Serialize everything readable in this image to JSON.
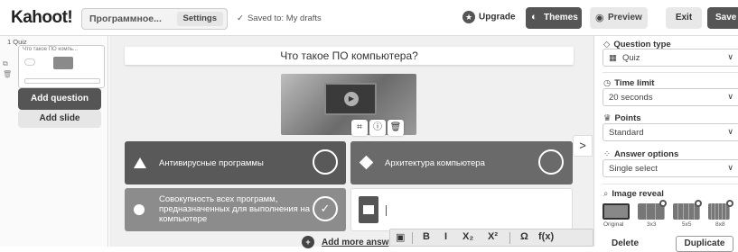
{
  "header": {
    "logo": "Kahoot!",
    "quiz_title": "Программное...",
    "settings_label": "Settings",
    "saved_text": "Saved to: My drafts",
    "upgrade_label": "Upgrade",
    "themes_label": "Themes",
    "preview_label": "Preview",
    "exit_label": "Exit",
    "save_label": "Save"
  },
  "sidebar": {
    "slide_label": "1 Quiz",
    "thumb_title": "Что такое ПО компь...",
    "add_question": "Add question",
    "add_slide": "Add slide"
  },
  "editor": {
    "question": "Что такое ПО компьютера?",
    "answers": [
      {
        "text": "Антивирусные программы",
        "shape": "triangle",
        "correct": false
      },
      {
        "text": "Архитектура компьютера",
        "shape": "diamond",
        "correct": false
      },
      {
        "text": "Совокупность всех программ, предназначенных для выполнения на компьютере",
        "shape": "circle",
        "correct": true
      },
      {
        "text": "",
        "shape": "square",
        "correct": false
      }
    ],
    "add_more": "Add more answ",
    "format_tools": [
      "B",
      "I",
      "X₂",
      "X²",
      "Ω",
      "f(x)"
    ]
  },
  "panel": {
    "question_type_label": "Question type",
    "question_type_value": "Quiz",
    "time_limit_label": "Time limit",
    "time_limit_value": "20 seconds",
    "points_label": "Points",
    "points_value": "Standard",
    "answer_options_label": "Answer options",
    "answer_options_value": "Single select",
    "image_reveal_label": "Image reveal",
    "reveal_options": [
      "Original",
      "3x3",
      "5x5",
      "8x8"
    ],
    "delete_label": "Delete",
    "duplicate_label": "Duplicate"
  }
}
